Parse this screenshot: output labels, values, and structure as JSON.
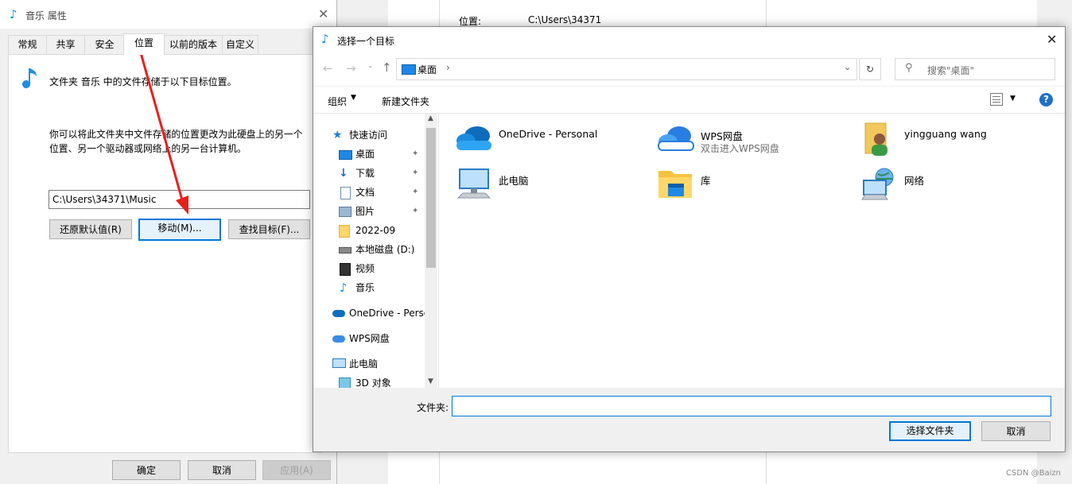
{
  "background_window": {
    "location_label": "位置:",
    "location_value": "C:\\Users\\34371"
  },
  "properties_dialog": {
    "title": "音乐 属性",
    "close": "✕",
    "tabs": [
      "常规",
      "共享",
      "安全",
      "位置",
      "以前的版本",
      "自定义"
    ],
    "active_tab": "位置",
    "description": "文件夹 音乐 中的文件存储于以下目标位置。",
    "move_hint_line1": "你可以将此文件夹中文件存储的位置更改为此硬盘上的另一个",
    "move_hint_line2": "位置、另一个驱动器或网络上的另一台计算机。",
    "path_value": "C:\\Users\\34371\\Music",
    "restore_button": "还原默认值(R)",
    "move_button": "移动(M)...",
    "find_target_button": "查找目标(F)...",
    "ok_button": "确定",
    "cancel_button": "取消",
    "apply_button": "应用(A)"
  },
  "picker_dialog": {
    "title": "选择一个目标",
    "close": "✕",
    "breadcrumb": "桌面",
    "breadcrumb_sep": "›",
    "search_placeholder": "搜索\"桌面\"",
    "organize_label": "组织",
    "new_folder_label": "新建文件夹",
    "help": "?",
    "nav_items": [
      {
        "label": "快速访问",
        "icon": "star-icon"
      },
      {
        "label": "桌面",
        "icon": "desktop-icon",
        "pinned": true
      },
      {
        "label": "下载",
        "icon": "download-icon",
        "pinned": true
      },
      {
        "label": "文档",
        "icon": "document-icon",
        "pinned": true
      },
      {
        "label": "图片",
        "icon": "picture-icon",
        "pinned": true
      },
      {
        "label": "2022-09",
        "icon": "folder-icon"
      },
      {
        "label": "本地磁盘 (D:)",
        "icon": "drive-icon"
      },
      {
        "label": "视频",
        "icon": "video-icon"
      },
      {
        "label": "音乐",
        "icon": "music-icon"
      },
      {
        "label": "OneDrive - Personal",
        "icon": "onedrive-icon"
      },
      {
        "label": "WPS网盘",
        "icon": "wps-cloud-icon"
      },
      {
        "label": "此电脑",
        "icon": "computer-icon"
      },
      {
        "label": "3D 对象",
        "icon": "3d-objects-icon"
      }
    ],
    "tiles": [
      {
        "label": "OneDrive - Personal",
        "sub": "",
        "icon": "onedrive-icon"
      },
      {
        "label": "WPS网盘",
        "sub": "双击进入WPS网盘",
        "icon": "wps-cloud-icon"
      },
      {
        "label": "yingguang wang",
        "sub": "",
        "icon": "user-folder-icon"
      },
      {
        "label": "此电脑",
        "sub": "",
        "icon": "computer-icon"
      },
      {
        "label": "库",
        "sub": "",
        "icon": "library-icon"
      },
      {
        "label": "网络",
        "sub": "",
        "icon": "network-icon"
      }
    ],
    "folder_label": "文件夹:",
    "folder_value": "",
    "select_button": "选择文件夹",
    "cancel_button": "取消"
  },
  "watermark": "CSDN @Baizn",
  "colors": {
    "accent": "#0078d7",
    "arrow": "#e8201c",
    "dialog_bg": "#f0f0f0"
  }
}
